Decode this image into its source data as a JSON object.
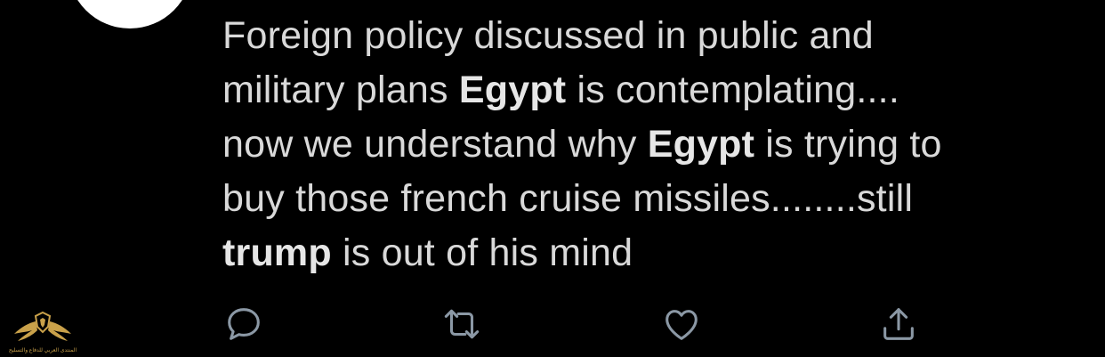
{
  "tweet": {
    "lines": [
      [
        {
          "text": "Foreign policy discussed in public and",
          "bold": false
        }
      ],
      [
        {
          "text": "military plans ",
          "bold": false
        },
        {
          "text": "Egypt",
          "bold": true
        },
        {
          "text": " is contemplating....",
          "bold": false
        }
      ],
      [
        {
          "text": "now we understand why ",
          "bold": false
        },
        {
          "text": "Egypt",
          "bold": true
        },
        {
          "text": " is trying to",
          "bold": false
        }
      ],
      [
        {
          "text": "buy those french cruise missiles........still",
          "bold": false
        }
      ],
      [
        {
          "text": "trump",
          "bold": true
        },
        {
          "text": " is out of his mind",
          "bold": false
        }
      ]
    ]
  },
  "actions": [
    {
      "name": "reply-icon"
    },
    {
      "name": "retweet-icon"
    },
    {
      "name": "like-icon"
    },
    {
      "name": "share-icon"
    }
  ],
  "colors": {
    "background": "#000000",
    "text": "#d9d9d9",
    "icon": "#8b98a5",
    "watermark_gold": "#c9a14a"
  },
  "watermark": {
    "caption": "المنتدى العربي للدفاع والتسليح"
  }
}
